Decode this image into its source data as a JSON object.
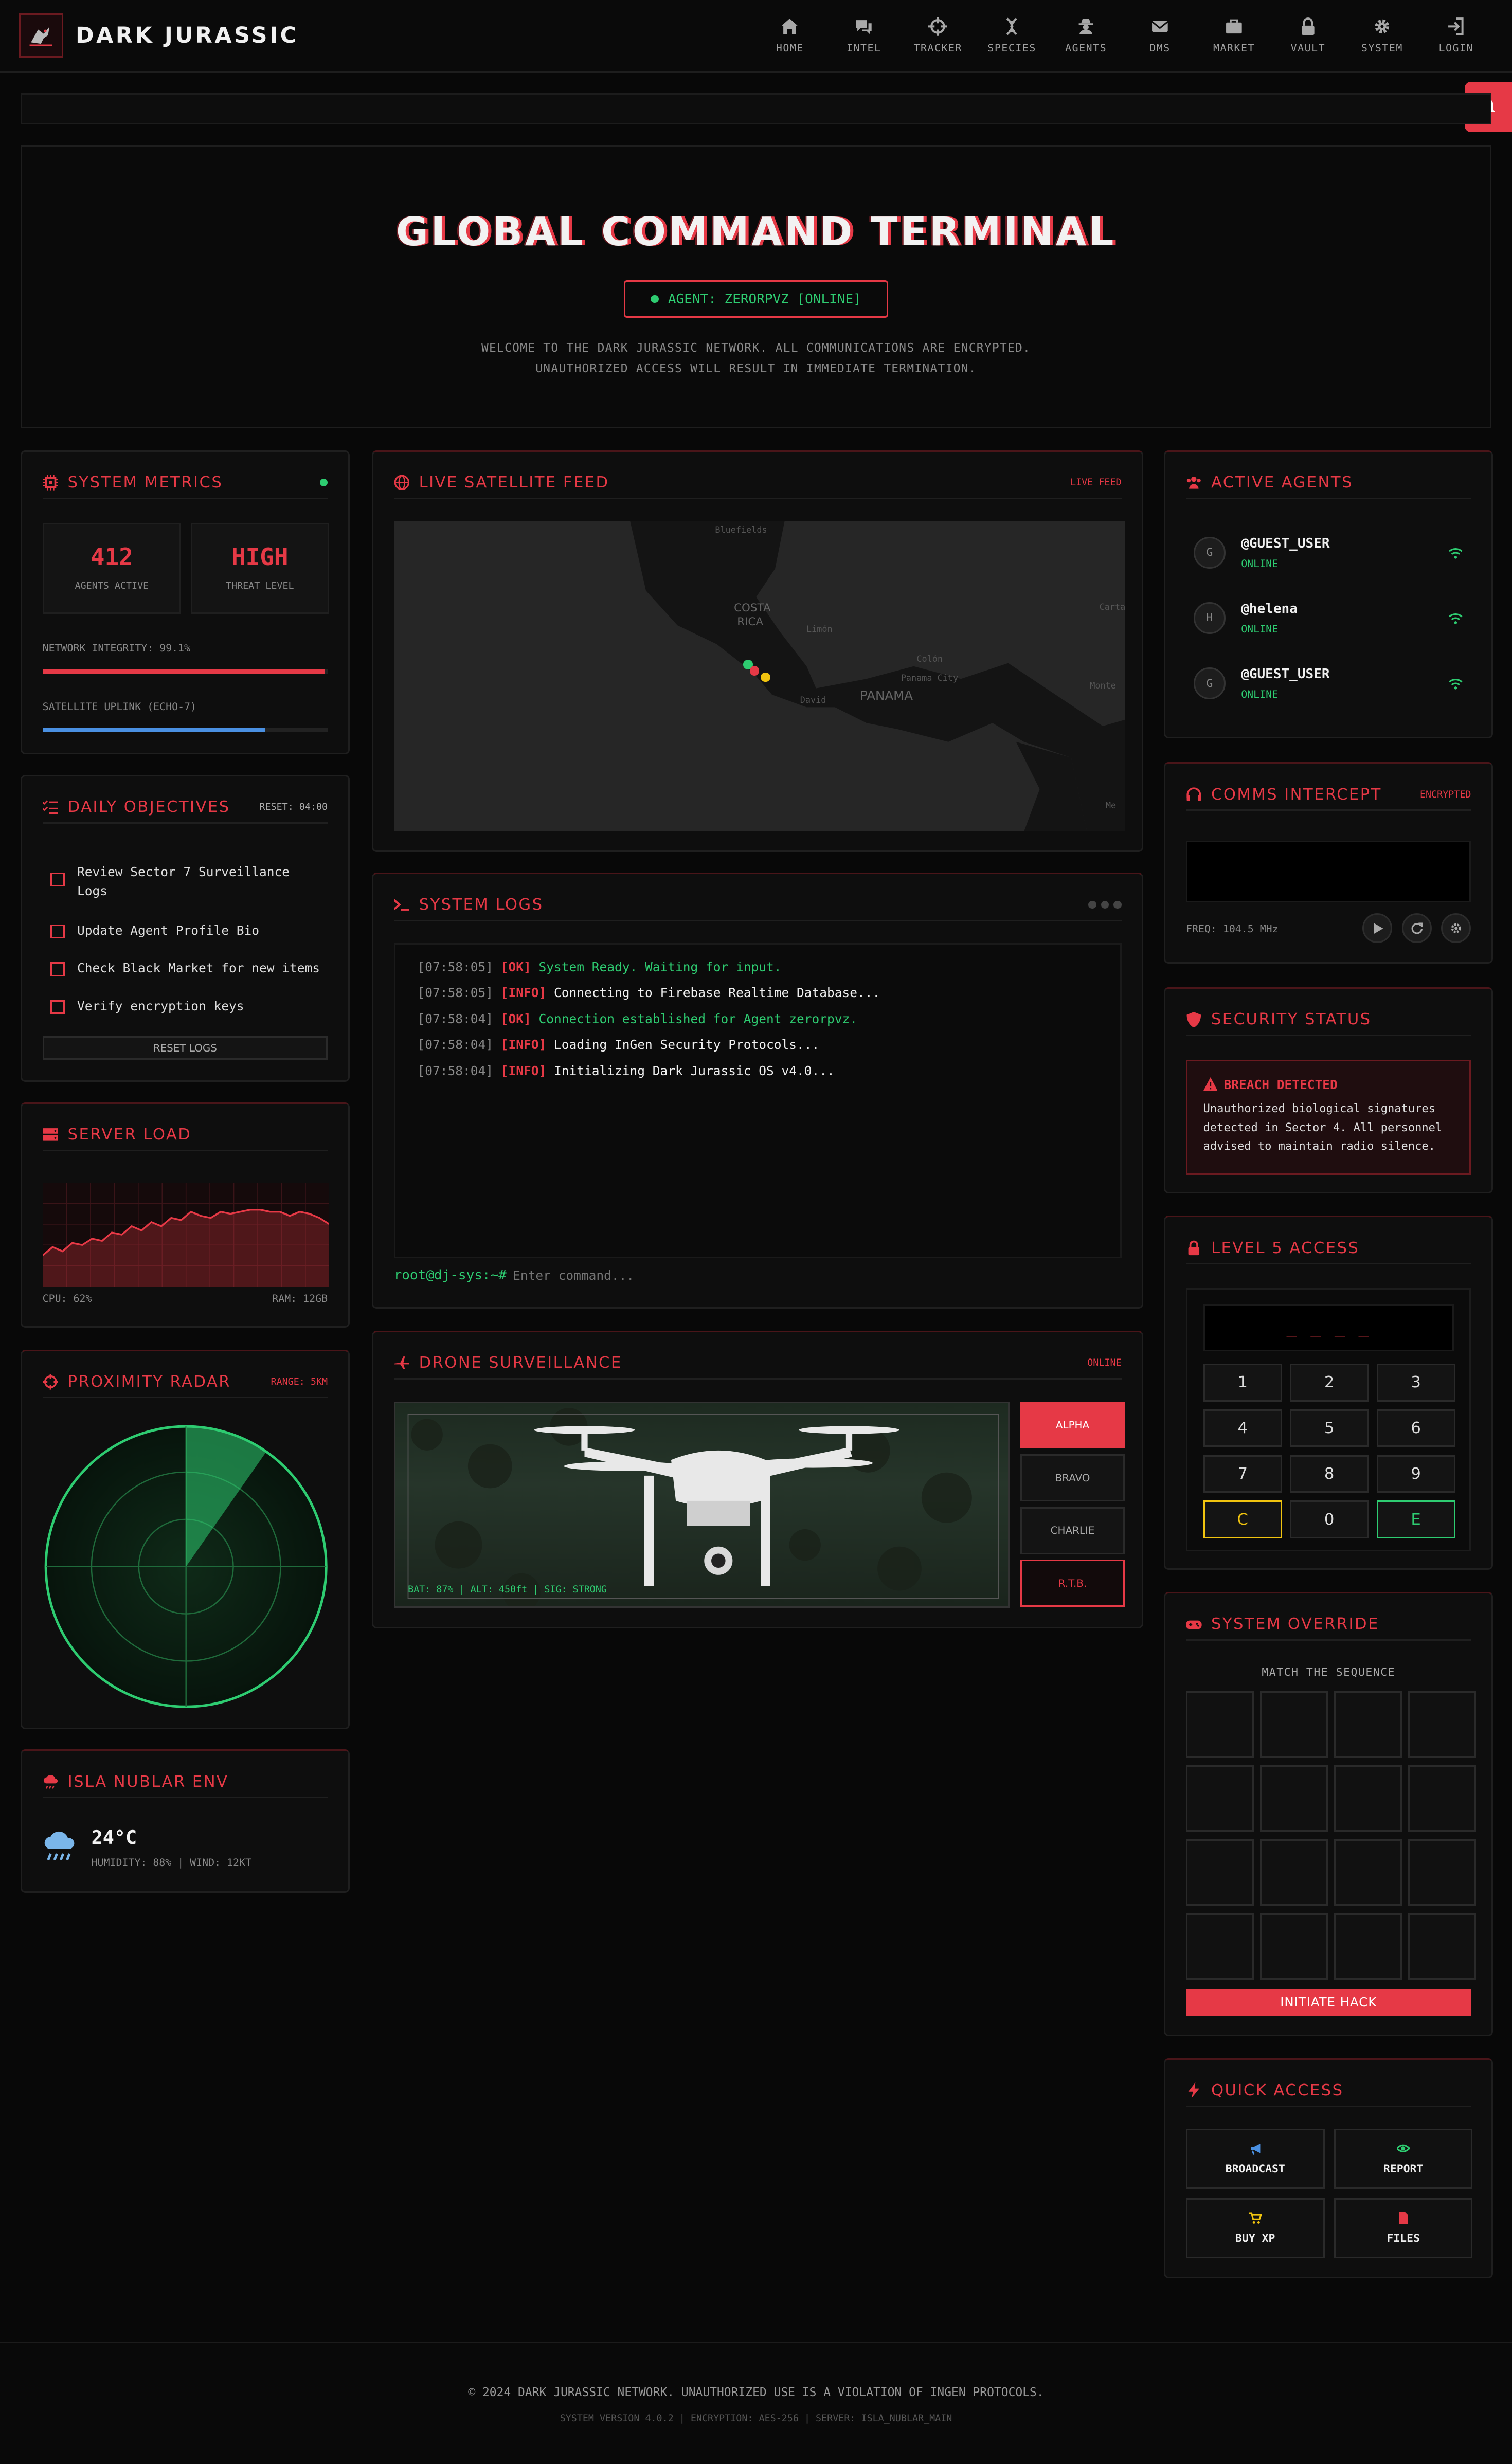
{
  "brand": {
    "name": "DARK JURASSIC"
  },
  "nav": [
    {
      "label": "HOME",
      "icon": "home-icon"
    },
    {
      "label": "INTEL",
      "icon": "chat-icon"
    },
    {
      "label": "TRACKER",
      "icon": "crosshair-icon"
    },
    {
      "label": "SPECIES",
      "icon": "dna-icon"
    },
    {
      "label": "AGENTS",
      "icon": "user-secret-icon"
    },
    {
      "label": "DMS",
      "icon": "envelope-icon"
    },
    {
      "label": "MARKET",
      "icon": "briefcase-icon"
    },
    {
      "label": "VAULT",
      "icon": "lock-icon"
    },
    {
      "label": "SYSTEM",
      "icon": "gear-icon"
    },
    {
      "label": "LOGIN",
      "icon": "login-icon"
    }
  ],
  "hero": {
    "title": "GLOBAL COMMAND TERMINAL",
    "agent": "AGENT: ZERORPVZ [ONLINE]",
    "line1": "WELCOME TO THE DARK JURASSIC NETWORK. ALL COMMUNICATIONS ARE ENCRYPTED.",
    "line2": "UNAUTHORIZED ACCESS WILL RESULT IN IMMEDIATE TERMINATION."
  },
  "metrics": {
    "title": "SYSTEM METRICS",
    "agents_value": "412",
    "agents_label": "AGENTS ACTIVE",
    "threat_value": "HIGH",
    "threat_label": "THREAT LEVEL",
    "integrity_label": "NETWORK INTEGRITY: 99.1%",
    "integrity": 0.991,
    "uplink_label": "SATELLITE UPLINK (ECHO-7)",
    "uplink": 0.78
  },
  "objectives": {
    "title": "DAILY OBJECTIVES",
    "reset_label": "RESET: 04:00",
    "items": [
      "Review Sector 7 Surveillance Logs",
      "Update Agent Profile Bio",
      "Check Black Market for new items",
      "Verify encryption keys"
    ],
    "reset_button": "RESET LOGS"
  },
  "server": {
    "title": "SERVER LOAD",
    "cpu": "CPU: 62%",
    "ram": "RAM: 12GB",
    "load": [
      30,
      38,
      34,
      42,
      40,
      46,
      44,
      52,
      50,
      58,
      54,
      62,
      58,
      66,
      64,
      72,
      68,
      66,
      72,
      70,
      72,
      74,
      74,
      72,
      72,
      68,
      72,
      70,
      66,
      60
    ]
  },
  "radar": {
    "title": "PROXIMITY RADAR",
    "range": "RANGE: 5KM"
  },
  "env": {
    "title": "ISLA NUBLAR ENV",
    "temp": "24°C",
    "details": "HUMIDITY: 88% | WIND: 12KT"
  },
  "satellite": {
    "title": "LIVE SATELLITE FEED",
    "badge": "LIVE FEED",
    "labels": [
      "Bluefields",
      "COSTA",
      "RICA",
      "Limón",
      "Colón",
      "Panama City",
      "David",
      "PANAMA",
      "Carta",
      "Monte",
      "Me"
    ]
  },
  "logs": {
    "title": "SYSTEM LOGS",
    "lines": [
      {
        "ts": "[07:58:05]",
        "tag": "[OK]",
        "msg": "System Ready. Waiting for input.",
        "green": true
      },
      {
        "ts": "[07:58:05]",
        "tag": "[INFO]",
        "msg": "Connecting to Firebase Realtime Database...",
        "green": false
      },
      {
        "ts": "[07:58:04]",
        "tag": "[OK]",
        "msg": "Connection established for Agent zerorpvz.",
        "green": true
      },
      {
        "ts": "[07:58:04]",
        "tag": "[INFO]",
        "msg": "Loading InGen Security Protocols...",
        "green": false
      },
      {
        "ts": "[07:58:04]",
        "tag": "[INFO]",
        "msg": "Initializing Dark Jurassic OS v4.0...",
        "green": false
      }
    ],
    "prompt": "root@dj-sys:~#",
    "placeholder": "Enter command..."
  },
  "drone": {
    "title": "DRONE SURVEILLANCE",
    "badge": "ONLINE",
    "hud": "BAT: 87% | ALT: 450ft | SIG: STRONG",
    "buttons": [
      "ALPHA",
      "BRAVO",
      "CHARLIE",
      "R.T.B."
    ]
  },
  "agents": {
    "title": "ACTIVE AGENTS",
    "list": [
      {
        "initial": "G",
        "name": "@GUEST_USER",
        "status": "ONLINE"
      },
      {
        "initial": "H",
        "name": "@helena",
        "status": "ONLINE"
      },
      {
        "initial": "G",
        "name": "@GUEST_USER",
        "status": "ONLINE"
      }
    ]
  },
  "comms": {
    "title": "COMMS INTERCEPT",
    "badge": "ENCRYPTED",
    "freq": "FREQ: 104.5 MHz"
  },
  "security": {
    "title": "SECURITY STATUS",
    "alert_title": "BREACH DETECTED",
    "alert_body": "Unauthorized biological signatures detected in Sector 4. All personnel advised to maintain radio silence."
  },
  "access": {
    "title": "LEVEL 5 ACCESS",
    "display": "_ _ _ _",
    "keys": [
      "1",
      "2",
      "3",
      "4",
      "5",
      "6",
      "7",
      "8",
      "9",
      "C",
      "0",
      "E"
    ]
  },
  "override": {
    "title": "SYSTEM OVERRIDE",
    "subtitle": "MATCH THE SEQUENCE",
    "button": "INITIATE HACK"
  },
  "quick": {
    "title": "QUICK ACCESS",
    "items": [
      {
        "label": "BROADCAST",
        "icon": "bullhorn-icon",
        "color": "#4a90e2"
      },
      {
        "label": "REPORT",
        "icon": "eye-icon",
        "color": "#2ecc71"
      },
      {
        "label": "BUY XP",
        "icon": "cart-icon",
        "color": "#f1c40f"
      },
      {
        "label": "FILES",
        "icon": "file-icon",
        "color": "#e63946"
      }
    ]
  },
  "footer": {
    "copy": "© 2024 DARK JURASSIC NETWORK. UNAUTHORIZED USE IS A VIOLATION OF INGEN PROTOCOLS.",
    "meta": "SYSTEM VERSION 4.0.2 | ENCRYPTION: AES-256 | SERVER: ISLA_NUBLAR_MAIN"
  },
  "colors": {
    "accent": "#e63946",
    "online": "#2ecc71",
    "link": "#4a90e2",
    "warn": "#f1c40f"
  }
}
